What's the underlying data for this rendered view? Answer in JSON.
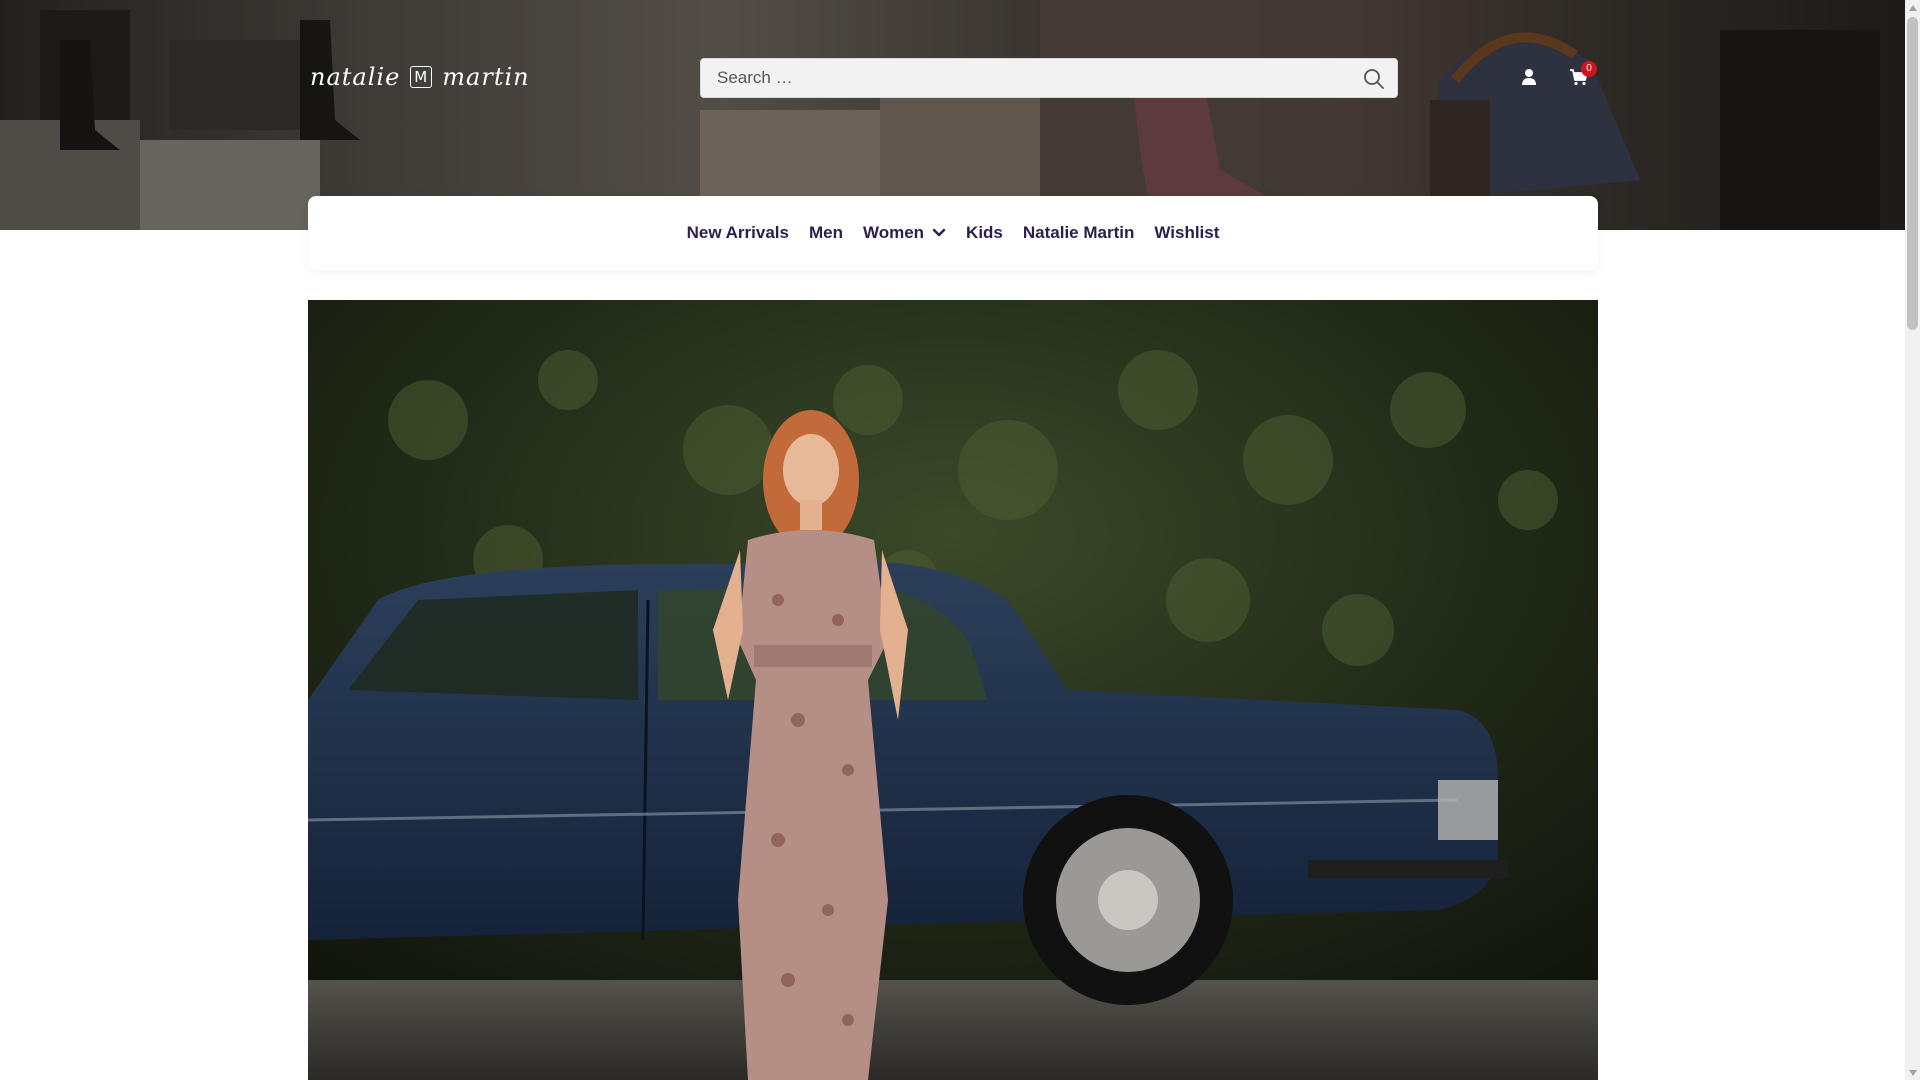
{
  "brand": {
    "logo_text_left": "natalie",
    "logo_monogram": "M",
    "logo_text_right": "martin"
  },
  "search": {
    "placeholder": "Search …",
    "icon": "search-icon"
  },
  "header_icons": {
    "account_icon": "user-icon",
    "cart_icon": "shopping-cart-icon",
    "cart_count": "0",
    "cart_badge_color": "#d0141b"
  },
  "nav": {
    "items": [
      {
        "label": "New Arrivals"
      },
      {
        "label": "Men"
      },
      {
        "label": "Women",
        "icon": "chevron-down-icon"
      },
      {
        "label": "Kids"
      },
      {
        "label": "Natalie Martin"
      },
      {
        "label": "Wishlist"
      }
    ],
    "text_color": "#2b1f4e"
  },
  "hero": {
    "image_description_icon": "hero-image"
  }
}
